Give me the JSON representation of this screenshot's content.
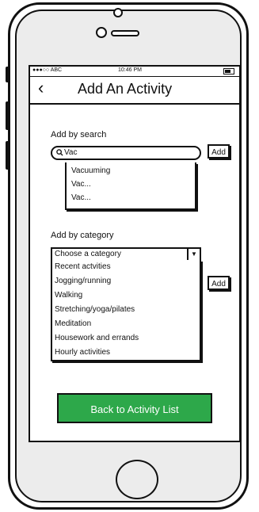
{
  "status_bar": {
    "carrier": "●●●○○ ABC",
    "time": "10:46 PM"
  },
  "nav": {
    "back_icon": "‹",
    "title": "Add An Activity"
  },
  "search_section": {
    "label": "Add by search",
    "search_icon": "magnifier-icon",
    "search_value": "Vac",
    "add_label": "Add",
    "suggestions": [
      "Vacuuming",
      "Vac...",
      "Vac..."
    ]
  },
  "category_section": {
    "label": "Add by category",
    "select_value": "Choose a category",
    "add_label": "Add",
    "options": [
      "Recent actvities",
      "Jogging/running",
      "Walking",
      "Stretching/yoga/pilates",
      "Meditation",
      "Housework and errands",
      "Hourly activities"
    ]
  },
  "primary_button": {
    "label": "Back to Activity List",
    "color": "#2da84a"
  }
}
